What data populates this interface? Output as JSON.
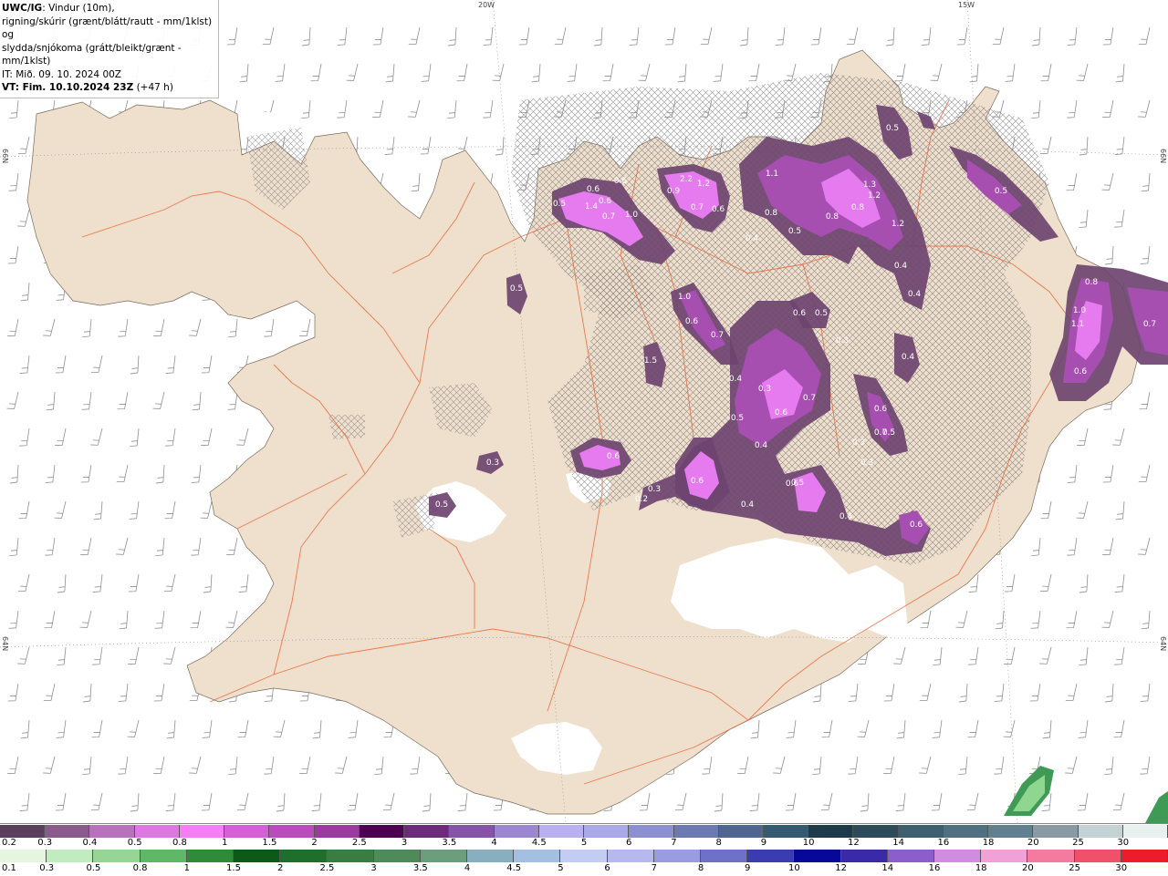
{
  "title": {
    "model": "UWC/IG",
    "line1_rest": ": Vindur (10m),",
    "line2": "rigning/skúrir (grænt/blátt/rautt - mm/1klst) og",
    "line3": "slydda/snjókoma (grátt/bleikt/grænt - mm/1klst)",
    "line4": "IT: Mið. 09. 10. 2024 00Z",
    "line5_bold": "VT: Fim. 10.10.2024 23Z",
    "line5_rest": " (+47 h)"
  },
  "coords": {
    "top_20w": "20W",
    "top_15w": "15W",
    "left_66n": "66N",
    "left_64n": "64N",
    "right_66n": "66N",
    "right_64n": "64N"
  },
  "colors": {
    "land": "#efdfcd",
    "sea": "#ffffff",
    "ice": "#ffffff",
    "roads": "#e8683a",
    "barbs": "#8f8f8f",
    "hatch": "#777777",
    "snow_dark": "#6e4470",
    "snow_mid": "#a64fb0",
    "snow_bright": "#e67bf0",
    "rain_green": "#3f9a55"
  },
  "precip_labels": [
    {
      "t": "0.5"
    },
    {
      "t": "0.6"
    },
    {
      "t": "1.4"
    },
    {
      "t": "0.6"
    },
    {
      "t": "0.6"
    },
    {
      "t": "1.0"
    },
    {
      "t": "0.7"
    },
    {
      "t": "0.9"
    },
    {
      "t": "2.2"
    },
    {
      "t": "1.2"
    },
    {
      "t": "0.7"
    },
    {
      "t": "0.6"
    },
    {
      "t": "1.1"
    },
    {
      "t": "0.8"
    },
    {
      "t": "1.3"
    },
    {
      "t": "1.2"
    },
    {
      "t": "0.8"
    },
    {
      "t": "0.8"
    },
    {
      "t": "1.2"
    },
    {
      "t": "0.5"
    },
    {
      "t": "0.4"
    },
    {
      "t": "0.5"
    },
    {
      "t": "0.4"
    },
    {
      "t": "0.4"
    },
    {
      "t": "0.5"
    },
    {
      "t": "1.0"
    },
    {
      "t": "0.6"
    },
    {
      "t": "0.7"
    },
    {
      "t": "0.6"
    },
    {
      "t": "0.5"
    },
    {
      "t": "0.3"
    },
    {
      "t": "0.4"
    },
    {
      "t": "0.4"
    },
    {
      "t": "0.3"
    },
    {
      "t": "0.6"
    },
    {
      "t": "0.7"
    },
    {
      "t": "0.5"
    },
    {
      "t": "0.6"
    },
    {
      "t": "0.7"
    },
    {
      "t": "0.5"
    },
    {
      "t": "0.4"
    },
    {
      "t": "0.3"
    },
    {
      "t": "0.3"
    },
    {
      "t": "0.6"
    },
    {
      "t": "0.3"
    },
    {
      "t": "0.2"
    },
    {
      "t": "0.4"
    },
    {
      "t": "0.6"
    },
    {
      "t": "0.4"
    },
    {
      "t": "0.6"
    },
    {
      "t": "0.8"
    },
    {
      "t": "1.0"
    },
    {
      "t": "1.1"
    },
    {
      "t": "0.6"
    },
    {
      "t": "0.7"
    },
    {
      "t": "0.5"
    },
    {
      "t": "0.3"
    },
    {
      "t": "0.5"
    },
    {
      "t": "0.6"
    },
    {
      "t": "1.5"
    },
    {
      "t": "0.5"
    }
  ],
  "legend_snow": {
    "labels": [
      "0.2",
      "0.3",
      "0.4",
      "0.5",
      "0.8",
      "1",
      "1.5",
      "2",
      "2.5",
      "3",
      "3.5",
      "4",
      "4.5",
      "5",
      "6",
      "7",
      "8",
      "9",
      "10",
      "12",
      "14",
      "16",
      "18",
      "20",
      "25",
      "30"
    ],
    "colors": [
      "#5b3d5c",
      "#8a5a8c",
      "#b871bb",
      "#dc78e0",
      "#f57df5",
      "#d65fd8",
      "#b94bbd",
      "#9b3ba0",
      "#4d0050",
      "#6b2a7a",
      "#8654a6",
      "#9d86d0",
      "#b8b0f0",
      "#a9a8e8",
      "#8c90d0",
      "#6b7ab0",
      "#4f6690",
      "#335a70",
      "#1d3a4a",
      "#2b4a5a",
      "#3d6070",
      "#4f7080",
      "#60808f",
      "#8a9aa5",
      "#c3d2d2",
      "#e8f0f0"
    ]
  },
  "legend_rain": {
    "labels": [
      "0.1",
      "0.3",
      "0.5",
      "0.8",
      "1",
      "1.5",
      "2",
      "2.5",
      "3",
      "3.5",
      "4",
      "4.5",
      "5",
      "6",
      "7",
      "8",
      "9",
      "10",
      "12",
      "14",
      "16",
      "18",
      "20",
      "25",
      "30"
    ],
    "colors": [
      "#e6f5e0",
      "#c1ebc0",
      "#97d595",
      "#5fb866",
      "#2f8a3a",
      "#0d5a18",
      "#1f6e2c",
      "#3a7d43",
      "#4f8a5a",
      "#6a9e7c",
      "#88aec0",
      "#a3c0e0",
      "#c3ccf3",
      "#b7b8ee",
      "#9a9ce0",
      "#6f70c8",
      "#3c3cb2",
      "#080898",
      "#3b2aa8",
      "#8b5ecb",
      "#d08ce0",
      "#f1a0d8",
      "#f47aa0",
      "#f0506a",
      "#ee1c2a"
    ]
  }
}
